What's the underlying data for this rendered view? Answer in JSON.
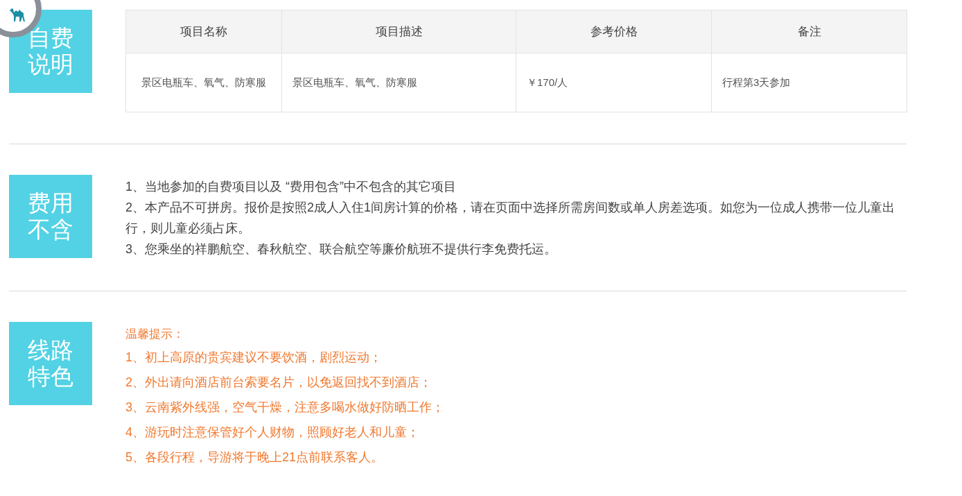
{
  "sections": [
    {
      "kind": "table",
      "label": "自费说明",
      "table": {
        "columns": [
          "项目名称",
          "项目描述",
          "参考价格",
          "备注"
        ],
        "rows": [
          [
            "景区电瓶车、氧气、防寒服",
            "景区电瓶车、氧气、防寒服",
            "￥170/人",
            "行程第3天参加"
          ]
        ]
      }
    },
    {
      "kind": "list",
      "label": "费用不含",
      "items": [
        "1、当地参加的自费项目以及 “费用包含”中不包含的其它项目",
        "2、本产品不可拼房。报价是按照2成人入住1间房计算的价格，请在页面中选择所需房间数或单人房差选项。如您为一位成人携带一位儿童出行，则儿童必须占床。",
        "3、您乘坐的祥鹏航空、春秋航空、联合航空等廉价航班不提供行李免费托运。"
      ]
    },
    {
      "kind": "tips",
      "label": "线路特色",
      "title": "温馨提示：",
      "items": [
        "1、初上高原的贵宾建议不要饮酒，剧烈运动；",
        "2、外出请向酒店前台索要名片，以免返回找不到酒店；",
        "3、云南紫外线强，空气干燥，注意多喝水做好防晒工作；",
        "4、游玩时注意保管好个人财物，照顾好老人和儿童；",
        "5、各段行程，导游将于晚上21点前联系客人。"
      ]
    }
  ]
}
